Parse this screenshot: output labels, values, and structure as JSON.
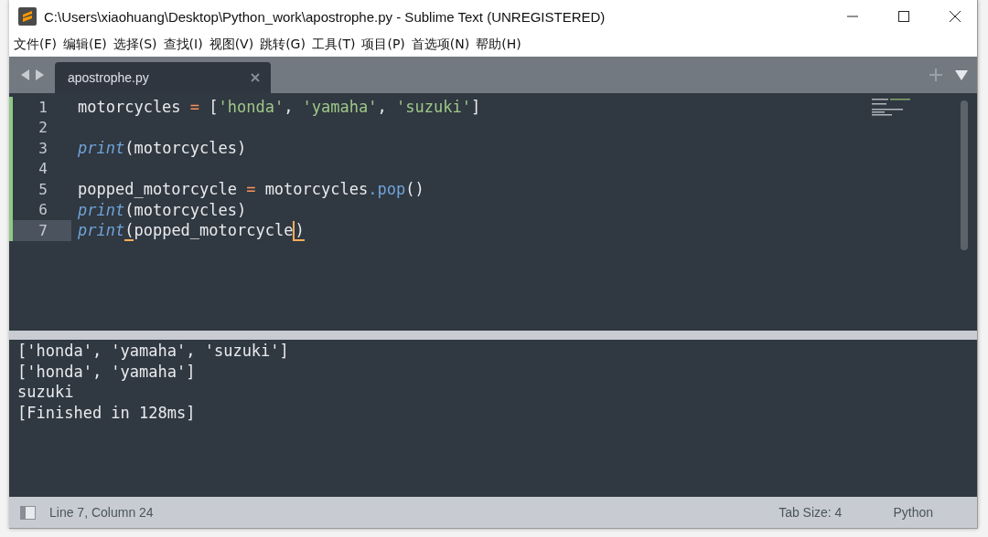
{
  "window": {
    "title": "C:\\Users\\xiaohuang\\Desktop\\Python_work\\apostrophe.py - Sublime Text (UNREGISTERED)"
  },
  "menu": [
    "文件(F)",
    "编辑(E)",
    "选择(S)",
    "查找(I)",
    "视图(V)",
    "跳转(G)",
    "工具(T)",
    "项目(P)",
    "首选项(N)",
    "帮助(H)"
  ],
  "tabs": [
    {
      "label": "apostrophe.py",
      "selected": true
    }
  ],
  "editor": {
    "lines": [
      {
        "number": "1",
        "current": false,
        "modified": true,
        "tokens": [
          {
            "kind": "name",
            "text": "motorcycles"
          },
          {
            "kind": "operator",
            "text": "="
          },
          {
            "kind": "punct",
            "text": "["
          },
          {
            "kind": "string",
            "text": "'honda'"
          },
          {
            "kind": "punct",
            "text": ", "
          },
          {
            "kind": "string",
            "text": "'yamaha'"
          },
          {
            "kind": "punct",
            "text": ", "
          },
          {
            "kind": "string",
            "text": "'suzuki'"
          },
          {
            "kind": "punct",
            "text": "]"
          }
        ]
      },
      {
        "number": "2",
        "current": false,
        "modified": true
      },
      {
        "number": "3",
        "current": false,
        "modified": true,
        "tokens": [
          {
            "kind": "builtin",
            "text": "print"
          },
          {
            "kind": "punct",
            "text": "("
          },
          {
            "kind": "name",
            "text": "motorcycles"
          },
          {
            "kind": "punct",
            "text": ")"
          }
        ]
      },
      {
        "number": "4",
        "current": false,
        "modified": true
      },
      {
        "number": "5",
        "current": false,
        "modified": true,
        "tokens": [
          {
            "kind": "name",
            "text": "popped_motorcycle"
          },
          {
            "kind": "operator",
            "text": "="
          },
          {
            "kind": "name",
            "text": "motorcycles"
          },
          {
            "kind": "method",
            "text": ".pop"
          },
          {
            "kind": "punct",
            "text": "()"
          }
        ]
      },
      {
        "number": "6",
        "current": false,
        "modified": true,
        "tokens": [
          {
            "kind": "builtin",
            "text": "print"
          },
          {
            "kind": "punct",
            "text": "("
          },
          {
            "kind": "name",
            "text": "motorcycles"
          },
          {
            "kind": "punct",
            "text": ")"
          }
        ]
      },
      {
        "number": "7",
        "current": true,
        "modified": true,
        "tokens": [
          {
            "kind": "builtin",
            "text": "print"
          },
          {
            "kind": "punct",
            "text": "(",
            "matched": true
          },
          {
            "kind": "name",
            "text": "popped_motorcycle"
          },
          {
            "kind": "punct",
            "text": ")",
            "matched": true,
            "caret": true
          }
        ]
      }
    ]
  },
  "output": {
    "lines": [
      "['honda', 'yamaha', 'suzuki']",
      "['honda', 'yamaha']",
      "suzuki",
      "[Finished in 128ms]"
    ]
  },
  "status_bar": {
    "position": "Line 7, Column 24",
    "tab_size": "Tab Size: 4",
    "syntax": "Python"
  }
}
